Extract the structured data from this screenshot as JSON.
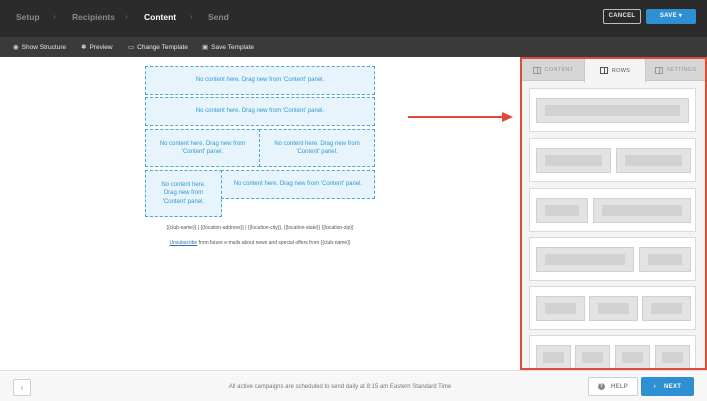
{
  "steps": [
    {
      "label": "Setup",
      "active": false
    },
    {
      "label": "Recipients",
      "active": false
    },
    {
      "label": "Content",
      "active": true
    },
    {
      "label": "Send",
      "active": false
    }
  ],
  "header": {
    "cancel_label": "CANCEL",
    "save_label": "SAVE",
    "save_caret": "▾"
  },
  "toolbar": {
    "show_structure": "Show Structure",
    "preview": "Preview",
    "change_template": "Change Template",
    "save_template": "Save Template"
  },
  "canvas": {
    "placeholder_text": "No content here. Drag new from 'Content' panel.",
    "placeholders": [
      "No content here. Drag new from 'Content' panel.",
      "No content here. Drag new from 'Content' panel.",
      "No content here. Drag new from 'Content' panel.",
      "No content here. Drag new from 'Content' panel.",
      "No content here. Drag new from 'Content' panel.",
      "No content here. Drag new from 'Content' panel."
    ],
    "footer_address": "{{club-name}} | {{location-address}} | {{location-city}}, {{location-state}} {{location-zip}}",
    "unsubscribe_link": "Unsubscribe",
    "unsubscribe_rest": " from future e-mails about news and special offers from {{club-name}}"
  },
  "panel": {
    "tabs": [
      {
        "label": "CONTENT",
        "active": false
      },
      {
        "label": "ROWS",
        "active": true
      },
      {
        "label": "SETTINGS",
        "active": false
      }
    ]
  },
  "footer": {
    "back_icon": "‹",
    "schedule_text": "All active campaigns are scheduled to send daily at 8:15 am Eastern Standard Time",
    "help_icon": "?",
    "help_label": "HELP",
    "next_icon": "›",
    "next_label": "NEXT"
  },
  "colors": {
    "accent": "#2f8fd3",
    "highlight": "#e04a3a",
    "placeholder_text": "#2f9ad3"
  }
}
